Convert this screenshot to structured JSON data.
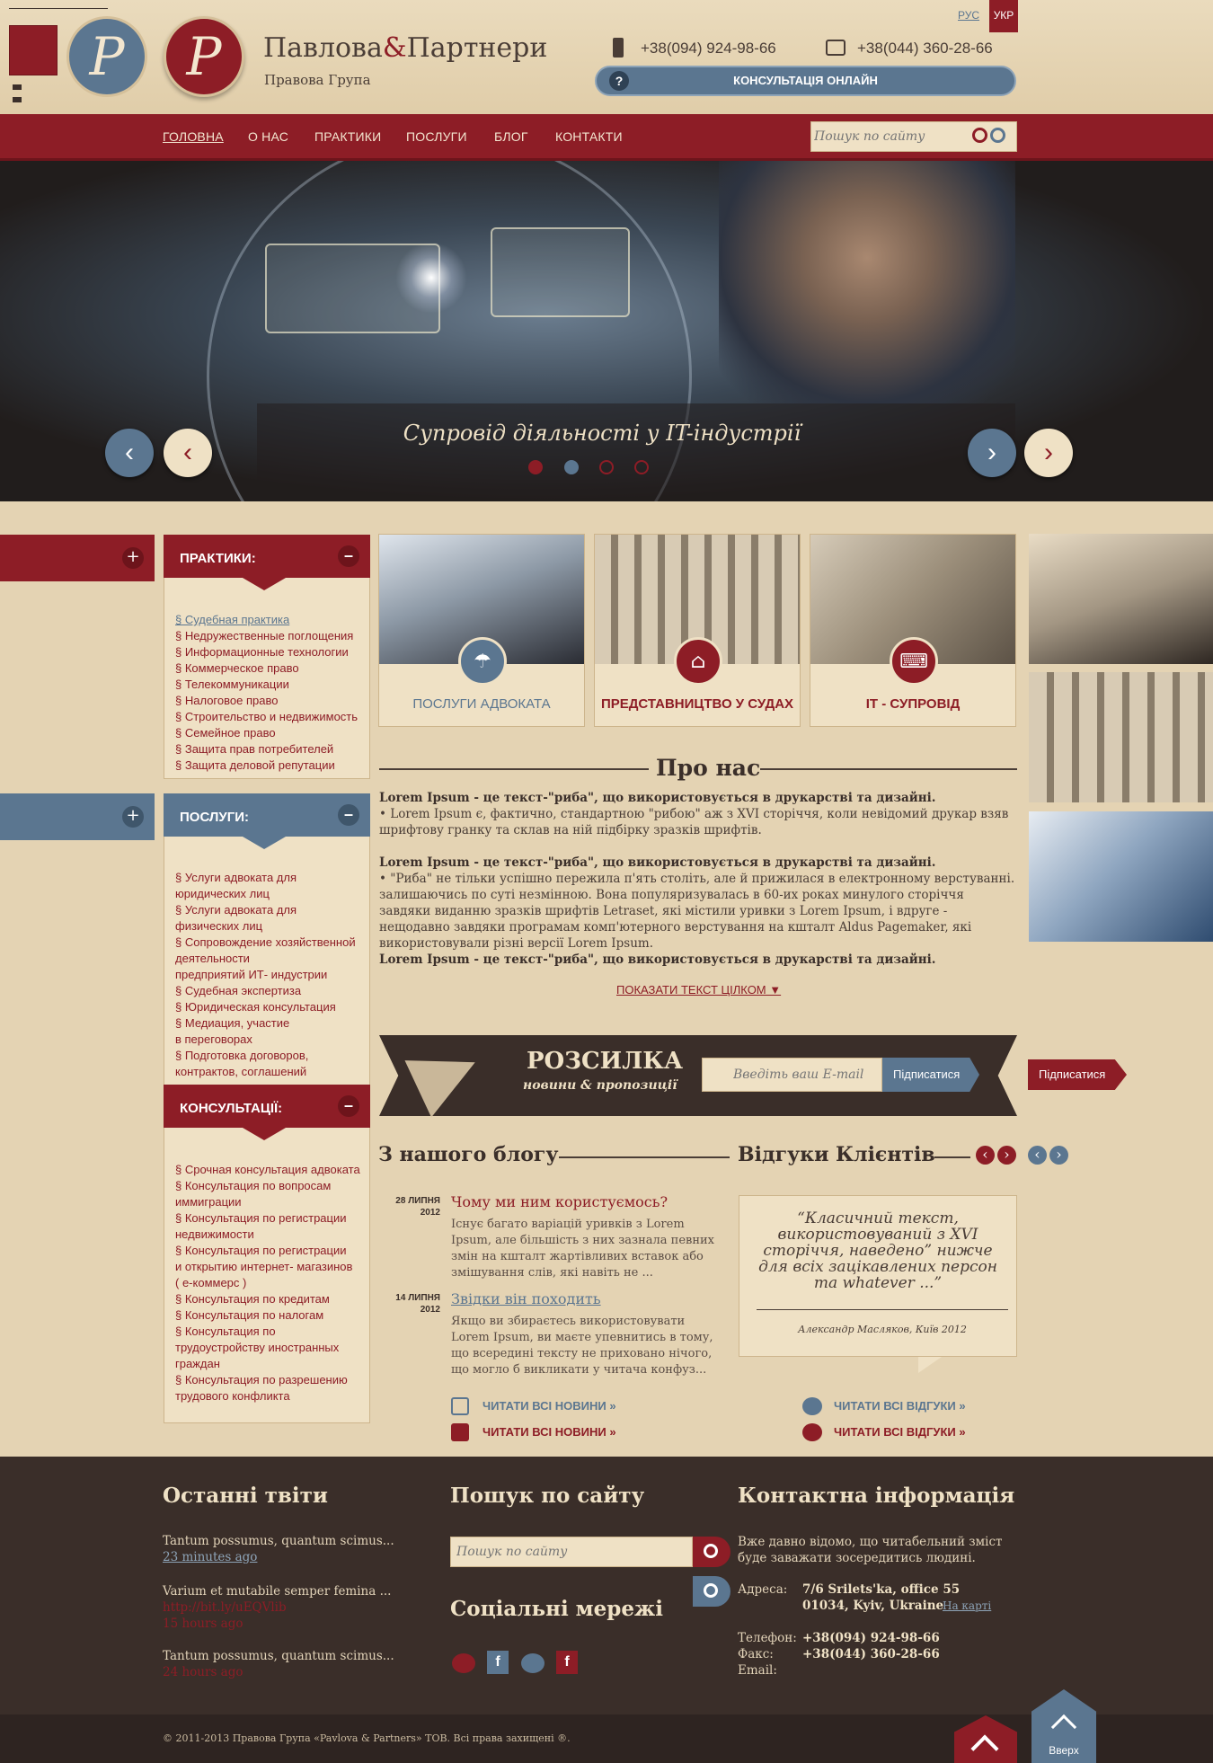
{
  "header": {
    "brand_name_1": "Павлова",
    "brand_amp": "&",
    "brand_name_2": "Партнери",
    "brand_sub": "Правова Група",
    "phone1": "+38(094) 924-98-66",
    "phone2": "+38(044) 360-28-66",
    "consult_button": "КОНСУЛЬТАЦІЯ ОНЛАЙН",
    "lang_ru": "РУС",
    "lang_uk": "УКР",
    "logo_letter": "P"
  },
  "nav": {
    "items": [
      "ГОЛОВНА",
      "О НАС",
      "ПРАКТИКИ",
      "ПОСЛУГИ",
      "БЛОГ",
      "КОНТАКТИ"
    ],
    "search_placeholder": "Пошук по сайту"
  },
  "hero": {
    "caption": "Супровід діяльності у IT-індустрії",
    "dots": 4,
    "active_dot": 2
  },
  "sidebar": {
    "practices_title": "ПРАКТИКИ:",
    "practices": [
      "§ Судебная практика",
      "§ Недружественные поглощения",
      "§ Информационные технологии",
      "§ Коммерческое право",
      "§ Телекоммуникации",
      "§ Налоговое право",
      "§ Строительство и недвижимость",
      "§ Семейное право",
      "§ Защита прав потребителей",
      "§ Защита деловой репутации"
    ],
    "services_title": "ПОСЛУГИ:",
    "services": [
      "§ Услуги адвоката для",
      "юридических лиц",
      "§ Услуги адвоката для",
      "физических лиц",
      "§ Сопровождение хозяйственной",
      "деятельности",
      "предприятий ИТ- индустрии",
      "§ Судебная экспертиза",
      "§ Юридическая консультация",
      "§ Медиация, участие",
      "в переговорах",
      "§ Подготовка договоров,",
      "контрактов, соглашений"
    ],
    "consult_title": "КОНСУЛЬТАЦІЇ:",
    "consults": [
      "§ Срочная консультация адвоката",
      "§ Консультация по вопросам",
      "иммиграции",
      "§ Консультация по регистрации",
      "недвижимости",
      "§ Консультация по регистрации",
      "и открытию интернет- магазинов",
      "( е-коммерс )",
      "§ Консультация по кредитам",
      "§ Консультация по налогам",
      "§ Консультация по",
      "трудоустройству иностранных",
      "граждан",
      "§ Консультация по разрешению",
      "трудового конфликта"
    ],
    "plus": "+",
    "minus": "–"
  },
  "cards": [
    {
      "label": "ПОСЛУГИ АДВОКАТА",
      "icon": "umbrella-icon",
      "glyph": "☂"
    },
    {
      "label": "ПРЕДСТАВНИЦТВО У СУДАХ",
      "icon": "courthouse-icon",
      "glyph": "⌂"
    },
    {
      "label": "IT - СУПРОВІД",
      "icon": "laptop-icon",
      "glyph": "⌨"
    }
  ],
  "about": {
    "title": "Про нас",
    "p1_bold": "Lorem Ipsum - це текст-\"риба\", що використовується в друкарстві та дизайні.",
    "p1_text": "• Lorem Ipsum є, фактично, стандартною \"рибою\" аж з XVI сторіччя, коли невідомий друкар взяв шрифтову гранку та склав на ній підбірку зразків шрифтів.",
    "p2_bold": "Lorem Ipsum - це текст-\"риба\", що використовується в друкарстві та дизайні.",
    "p2_text": "• \"Риба\" не тільки успішно пережила п'ять століть, але й прижилася в електронному верстуванні. залишаючись по суті незмінною. Вона популяризувалась в 60-их роках минулого сторіччя завдяки виданню зразків шрифтів Letraset, які містили уривки з Lorem Ipsum, і вдруге - нещодавно завдяки програмам комп'ютерного верстування на кшталт Aldus Pagemaker, які використовували різні версії Lorem Ipsum.",
    "p3_bold": "Lorem Ipsum - це текст-\"риба\", що використовується в друкарстві та дизайні.",
    "show_more": "ПОКАЗАТИ ТЕКСТ ЦІЛКОМ ▼"
  },
  "newsletter": {
    "title": "РОЗСИЛКА",
    "subtitle": "новини & пропозиції",
    "placeholder": "Введіть ваш E-mail",
    "button": "Підписатися",
    "button_alt": "Підписатися"
  },
  "blog": {
    "title": "З нашого блогу",
    "posts": [
      {
        "day": "28 ЛИПНЯ",
        "year": "2012",
        "title": "Чому ми ним користуємось?",
        "text": "Існує багато варіацій уривків з Lorem Ipsum, але більшість з них зазнала певних змін на кшталт жартівливих вставок або змішування слів, які навіть не ..."
      },
      {
        "day": "14 ЛИПНЯ",
        "year": "2012",
        "title": "Звідки він походить",
        "text": "Якщо ви збираєтесь використовувати Lorem Ipsum, ви маєте упевнитись в тому, що всередині тексту не приховано нічого, що могло б викликати у читача конфуз..."
      }
    ],
    "read_all": "ЧИТАТИ ВСІ НОВИНИ »",
    "read_all_alt": "ЧИТАТИ ВСІ НОВИНИ »"
  },
  "reviews": {
    "title": "Відгуки Клієнтів",
    "quote": "“Класичний текст, використовуваний з XVI сторіччя, наведено” нижче для всіх зацікавлених персон та whatever ...”",
    "author": "Александр Масляков, Київ 2012",
    "read_all": "ЧИТАТИ ВСІ ВІДГУКИ »",
    "read_all_alt": "ЧИТАТИ ВСІ ВІДГУКИ »",
    "prev": "‹",
    "next": "›"
  },
  "footer": {
    "tweets_title": "Останні твіти",
    "tweets": [
      {
        "text": "Tantum possumus, quantum scimus...",
        "meta": "23 minutes ago"
      },
      {
        "text": "Varium et mutabile semper femina ...",
        "link": "http://bit.ly/uEQVlib",
        "meta": "15 hours ago"
      },
      {
        "text": "Tantum possumus, quantum scimus...",
        "meta": "24 hours ago"
      }
    ],
    "search_title": "Пошук по сайту",
    "search_placeholder": "Пошук по сайту",
    "social_title": "Соціальні мережі",
    "contact_title": "Контактна інформація",
    "contact_intro": "Вже давно відомо, що читабельний зміст буде заважати зосередитись людині.",
    "address_label": "Адреса:",
    "address_line1": "7/6 Srilets'ka, office 55",
    "address_line2": "01034, Kyiv, Ukraine",
    "map_link": "На карті",
    "phone_label": "Телефон:",
    "phone": "+38(094) 924-98-66",
    "fax_label": "Факс:",
    "fax": "+38(044) 360-28-66",
    "email_label": "Email:"
  },
  "copyright": "© 2011-2013 Правова Група «Pavlova & Partners» ТОВ. Всі права захищені ®.",
  "up_label": "Вверх",
  "colors": {
    "accent": "#8d1d26",
    "blue": "#5b7690",
    "beige": "#e4d3b3",
    "dark": "#3a2e29"
  }
}
